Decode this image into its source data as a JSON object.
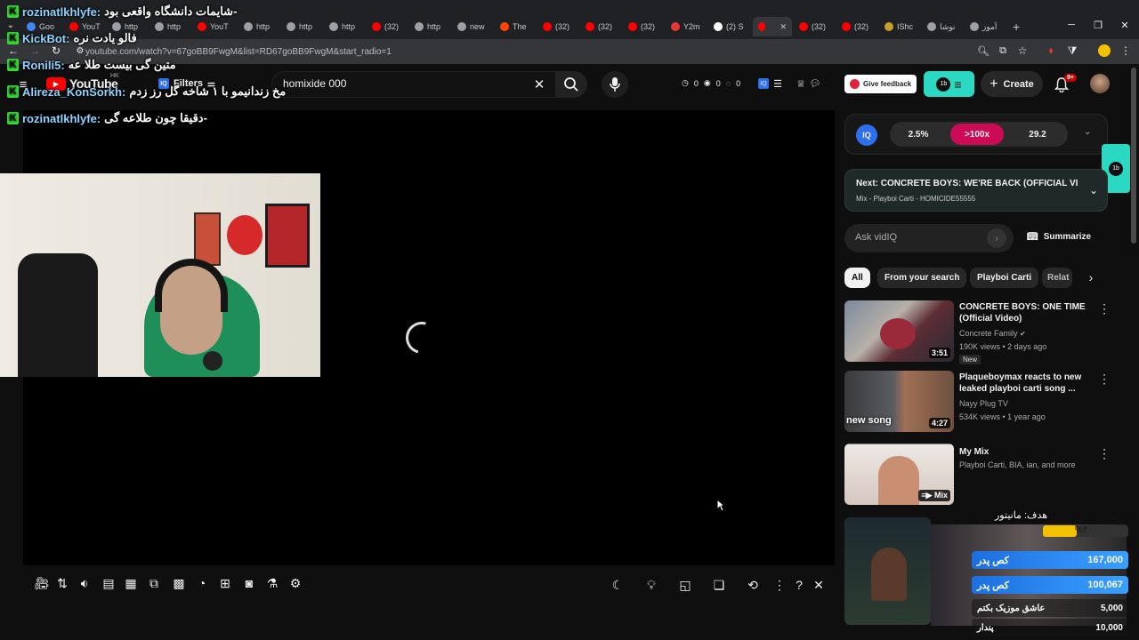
{
  "browser": {
    "tabs": [
      {
        "label": "Goo",
        "color": "#4285f4"
      },
      {
        "label": "YouT",
        "color": "#ff0000"
      },
      {
        "label": "http",
        "color": "#9aa0a6"
      },
      {
        "label": "http",
        "color": "#9aa0a6"
      },
      {
        "label": "YouT",
        "color": "#ff0000"
      },
      {
        "label": "http",
        "color": "#9aa0a6"
      },
      {
        "label": "http",
        "color": "#9aa0a6"
      },
      {
        "label": "http",
        "color": "#9aa0a6"
      },
      {
        "label": "(32)",
        "color": "#ff0000"
      },
      {
        "label": "http",
        "color": "#9aa0a6"
      },
      {
        "label": "new",
        "color": "#9aa0a6"
      },
      {
        "label": "The",
        "color": "#ff4500"
      },
      {
        "label": "(32)",
        "color": "#ff0000"
      },
      {
        "label": "(32)",
        "color": "#ff0000"
      },
      {
        "label": "(32)",
        "color": "#ff0000"
      },
      {
        "label": "Y2m",
        "color": "#e53935"
      },
      {
        "label": "(2) S",
        "color": "#ffffff"
      }
    ],
    "active_tab": {
      "label": "",
      "close": "✕"
    },
    "tabs_after": [
      {
        "label": "(32)",
        "color": "#ff0000"
      },
      {
        "label": "(32)",
        "color": "#ff0000"
      },
      {
        "label": "IShc",
        "color": "#c7a02a"
      },
      {
        "label": "نوشا",
        "color": "#9aa0a6"
      },
      {
        "label": "آموز",
        "color": "#9aa0a6"
      }
    ],
    "new_tab": "+",
    "url": "youtube.com/watch?v=67goBB9FwgM&list=RD67goBB9FwgM&start_radio=1"
  },
  "header": {
    "logo_text": "YouTube",
    "region": "HK",
    "filters_label": "Filters",
    "search_value": "homixide 000",
    "counters": [
      "0",
      "0",
      "0"
    ],
    "give_feedback": "Give feedback",
    "create_label": "Create",
    "notif_badge": "9+"
  },
  "chat": [
    {
      "user": "rozinatlkhlyfe:",
      "msg": "شایمات دانشگاه واقعی بود-"
    },
    {
      "user": "KickBot:",
      "msg": "فالو یادت نره"
    },
    {
      "user": "Ronili5:",
      "msg": "متین گی بیست طلا عه"
    },
    {
      "user": "Alireza_KonSorkh:",
      "msg": "مخ زندانیمو با ۱ شاخه گل رز زدم"
    },
    {
      "user": "rozinatlkhlyfe:",
      "msg": "دقیقا چون طلاعه گی-"
    }
  ],
  "iq_panel": {
    "logo": "IQ",
    "stat1": "2.5%",
    "stat2": ">100x",
    "stat3": "29.2",
    "next_title": "Next: CONCRETE BOYS: WE'RE BACK (OFFICIAL VI...",
    "next_sub": "Mix - Playboi Carti - HOMICIDE55555",
    "ask_placeholder": "Ask vidIQ",
    "summarize": "Summarize"
  },
  "chips": [
    "All",
    "From your search",
    "Playboi Carti",
    "Relat"
  ],
  "videos": [
    {
      "title": "CONCRETE BOYS: ONE TIME (Official Video)",
      "channel": "Concrete Family",
      "meta": "190K views • 2 days ago",
      "badge": "New",
      "duration": "3:51"
    },
    {
      "title": "Plaqueboymax reacts to new leaked playboi carti song ...",
      "channel": "Nayy Plug TV",
      "meta": "534K views • 1 year ago",
      "badge": "",
      "duration": "4:27",
      "thumb_text": "new song"
    },
    {
      "title": "My Mix",
      "channel": "Playboi Carti, BIA, ian, and more",
      "meta": "",
      "badge": "",
      "duration": "Mix"
    }
  ],
  "donation_widget": {
    "goal": "هدف: مانیتور",
    "percent": "%۴۰",
    "progress": 0.4,
    "rows": [
      {
        "name": "کص پدر",
        "amount": "167,000"
      },
      {
        "name": "کص پدر",
        "amount": "100,067"
      },
      {
        "name": "عاشق موزیک بکتم",
        "amount": "5,000"
      },
      {
        "name": "پندار",
        "amount": "10,000"
      }
    ]
  },
  "colors": {
    "accent": "#2bd9c3",
    "red": "#cc0a55",
    "youtube_red": "#ff0000"
  }
}
